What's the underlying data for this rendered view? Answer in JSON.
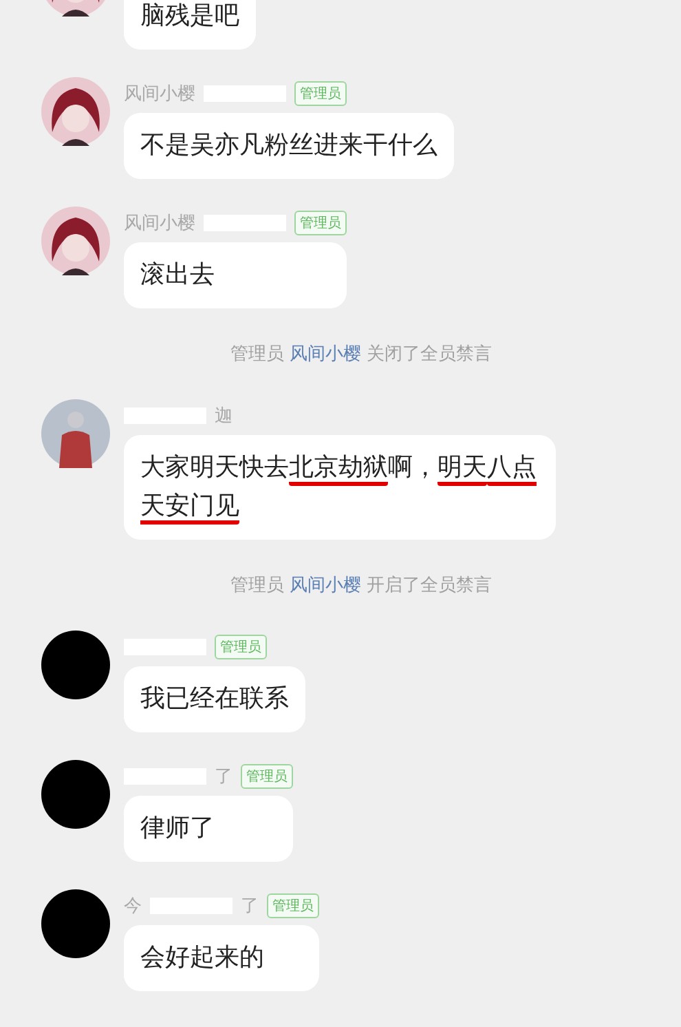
{
  "messages": [
    {
      "avatar": {
        "kind": "anime"
      },
      "text": [
        {
          "t": "脑残是吧"
        }
      ],
      "kind": "message"
    },
    {
      "avatar": {
        "kind": "anime"
      },
      "name": [
        {
          "kind": "text",
          "t": "风间小樱"
        },
        {
          "kind": "redacted"
        }
      ],
      "badge": "管理员",
      "text": [
        {
          "t": "不是吴亦凡粉丝进来干什么"
        }
      ],
      "kind": "message"
    },
    {
      "avatar": {
        "kind": "anime"
      },
      "name": [
        {
          "kind": "text",
          "t": "风间小樱"
        },
        {
          "kind": "redacted"
        }
      ],
      "badge": "管理员",
      "text": [
        {
          "t": "滚出去"
        }
      ],
      "kind": "message"
    },
    {
      "kind": "system",
      "parts": [
        "管理员",
        "风间小樱",
        "关闭了全员禁言"
      ]
    },
    {
      "avatar": {
        "kind": "figure"
      },
      "name": [
        {
          "kind": "redacted"
        },
        {
          "kind": "text",
          "t": "迦"
        }
      ],
      "text": [
        {
          "t": "大家明天快去"
        },
        {
          "t": "北京劫狱",
          "underline": true
        },
        {
          "t": "啊，"
        },
        {
          "t": "明天",
          "underline": true
        },
        {
          "t": "八点天安门见",
          "underline": true
        }
      ],
      "kind": "message"
    },
    {
      "kind": "system",
      "parts": [
        "管理员",
        "风间小樱",
        "开启了全员禁言"
      ]
    },
    {
      "avatar": {
        "kind": "black"
      },
      "name": [
        {
          "kind": "redacted"
        }
      ],
      "badge": "管理员",
      "text": [
        {
          "t": "我已经在联系"
        }
      ],
      "kind": "message"
    },
    {
      "avatar": {
        "kind": "black"
      },
      "name": [
        {
          "kind": "redacted"
        },
        {
          "kind": "text",
          "t": "了"
        }
      ],
      "badge": "管理员",
      "text": [
        {
          "t": "律师了"
        }
      ],
      "kind": "message"
    },
    {
      "avatar": {
        "kind": "black"
      },
      "name": [
        {
          "kind": "text",
          "t": "今"
        },
        {
          "kind": "redacted"
        },
        {
          "kind": "text",
          "t": "了"
        }
      ],
      "badge": "管理员",
      "text": [
        {
          "t": "会好起来的"
        }
      ],
      "kind": "message"
    }
  ]
}
